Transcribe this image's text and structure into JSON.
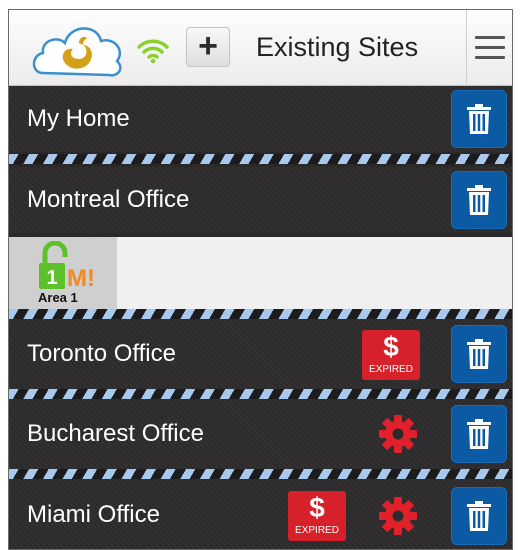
{
  "header": {
    "title": "Existing Sites",
    "add_label": "+",
    "logo": "swan-cloud-logo",
    "wifi": "wifi-icon",
    "menu": "hamburger-menu-icon"
  },
  "sites": [
    {
      "name": "My Home",
      "expired": false,
      "settings": false
    },
    {
      "name": "Montreal Office",
      "expired": false,
      "settings": false
    },
    {
      "name": "Toronto Office",
      "expired": true,
      "settings": false
    },
    {
      "name": "Bucharest Office",
      "expired": false,
      "settings": true
    },
    {
      "name": "Miami Office",
      "expired": true,
      "settings": true
    }
  ],
  "area": {
    "label": "Area 1",
    "badge_number": "1",
    "badge_text": "M!"
  },
  "expired_badge": {
    "symbol": "$",
    "text": "EXPIRED"
  },
  "colors": {
    "delete": "#0b5aa3",
    "expired": "#d6202a",
    "gear": "#e0202a",
    "wifi": "#8bd12c",
    "lock": "#5cc12b",
    "badge_m": "#f08a24"
  }
}
